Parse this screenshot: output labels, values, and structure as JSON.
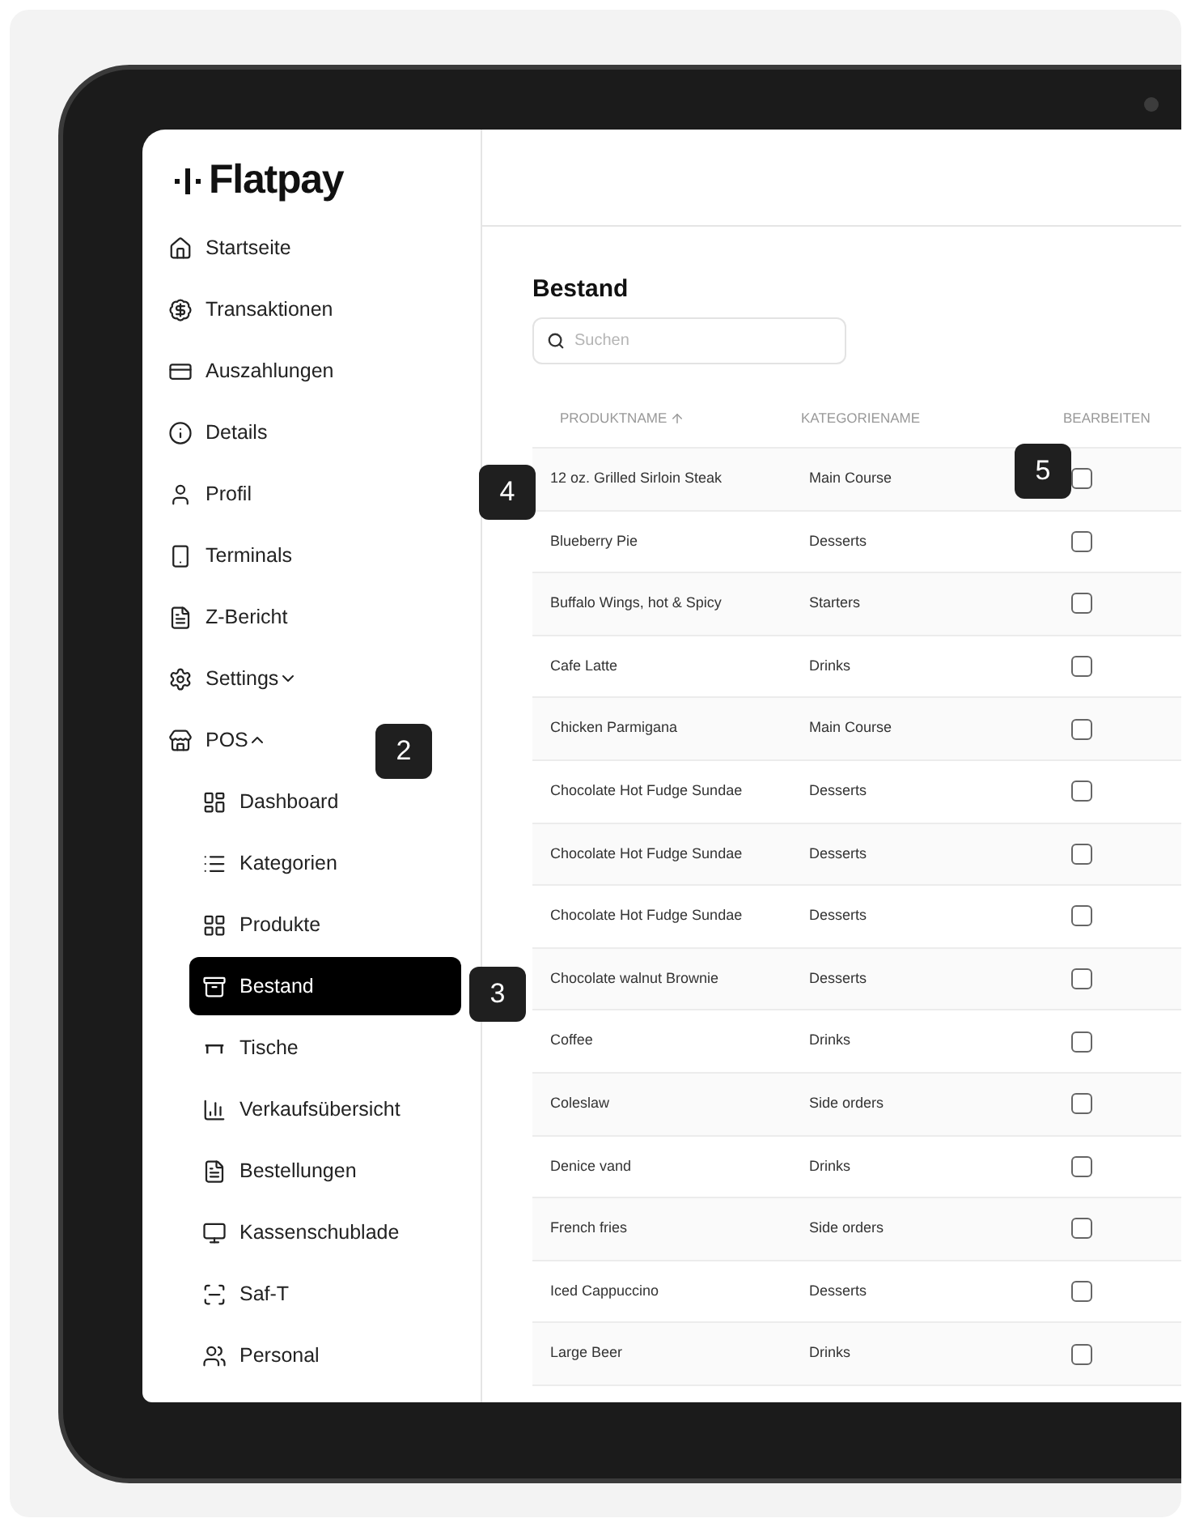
{
  "brand": {
    "name": "Flatpay"
  },
  "sidebar": {
    "items": [
      {
        "label": "Startseite",
        "selected": false
      },
      {
        "label": "Transaktionen",
        "selected": false
      },
      {
        "label": "Auszahlungen",
        "selected": false
      },
      {
        "label": "Details",
        "selected": false
      },
      {
        "label": "Profil",
        "selected": false
      },
      {
        "label": "Terminals",
        "selected": false
      },
      {
        "label": "Z-Bericht",
        "selected": false
      },
      {
        "label": "Settings",
        "selected": false,
        "expanded": false
      },
      {
        "label": "POS",
        "selected": false,
        "expanded": true,
        "children": [
          {
            "label": "Dashboard",
            "selected": false
          },
          {
            "label": "Kategorien",
            "selected": false
          },
          {
            "label": "Produkte",
            "selected": false
          },
          {
            "label": "Bestand",
            "selected": true
          },
          {
            "label": "Tische",
            "selected": false
          },
          {
            "label": "Verkaufsübersicht",
            "selected": false
          },
          {
            "label": "Bestellungen",
            "selected": false
          },
          {
            "label": "Kassenschublade",
            "selected": false
          },
          {
            "label": "Saf-T",
            "selected": false
          },
          {
            "label": "Personal",
            "selected": false
          }
        ]
      }
    ]
  },
  "main": {
    "title": "Bestand",
    "search": {
      "placeholder": "Suchen"
    }
  },
  "table": {
    "columns": [
      {
        "label": "PRODUKTNAME",
        "sorted": true
      },
      {
        "label": "KATEGORIENAME",
        "sorted": false
      },
      {
        "label": "BEARBEITEN",
        "sorted": false
      }
    ],
    "rows": [
      {
        "product": "12 oz. Grilled Sirloin Steak",
        "category": "Main Course",
        "checked": false
      },
      {
        "product": "Blueberry Pie",
        "category": "Desserts",
        "checked": false
      },
      {
        "product": "Buffalo Wings, hot & Spicy",
        "category": "Starters",
        "checked": false
      },
      {
        "product": "Cafe Latte",
        "category": "Drinks",
        "checked": false
      },
      {
        "product": "Chicken Parmigana",
        "category": "Main Course",
        "checked": false
      },
      {
        "product": "Chocolate Hot Fudge Sundae",
        "category": "Desserts",
        "checked": false
      },
      {
        "product": "Chocolate Hot Fudge Sundae",
        "category": "Desserts",
        "checked": false
      },
      {
        "product": "Chocolate Hot Fudge Sundae",
        "category": "Desserts",
        "checked": false
      },
      {
        "product": "Chocolate walnut Brownie",
        "category": "Desserts",
        "checked": false
      },
      {
        "product": "Coffee",
        "category": "Drinks",
        "checked": false
      },
      {
        "product": "Coleslaw",
        "category": "Side orders",
        "checked": false
      },
      {
        "product": "Denice vand",
        "category": "Drinks",
        "checked": false
      },
      {
        "product": "French fries",
        "category": "Side orders",
        "checked": false
      },
      {
        "product": "Iced Cappuccino",
        "category": "Desserts",
        "checked": false
      },
      {
        "product": "Large Beer",
        "category": "Drinks",
        "checked": false
      }
    ]
  },
  "callouts": [
    {
      "label": "2"
    },
    {
      "label": "3"
    },
    {
      "label": "4"
    },
    {
      "label": "5"
    }
  ]
}
